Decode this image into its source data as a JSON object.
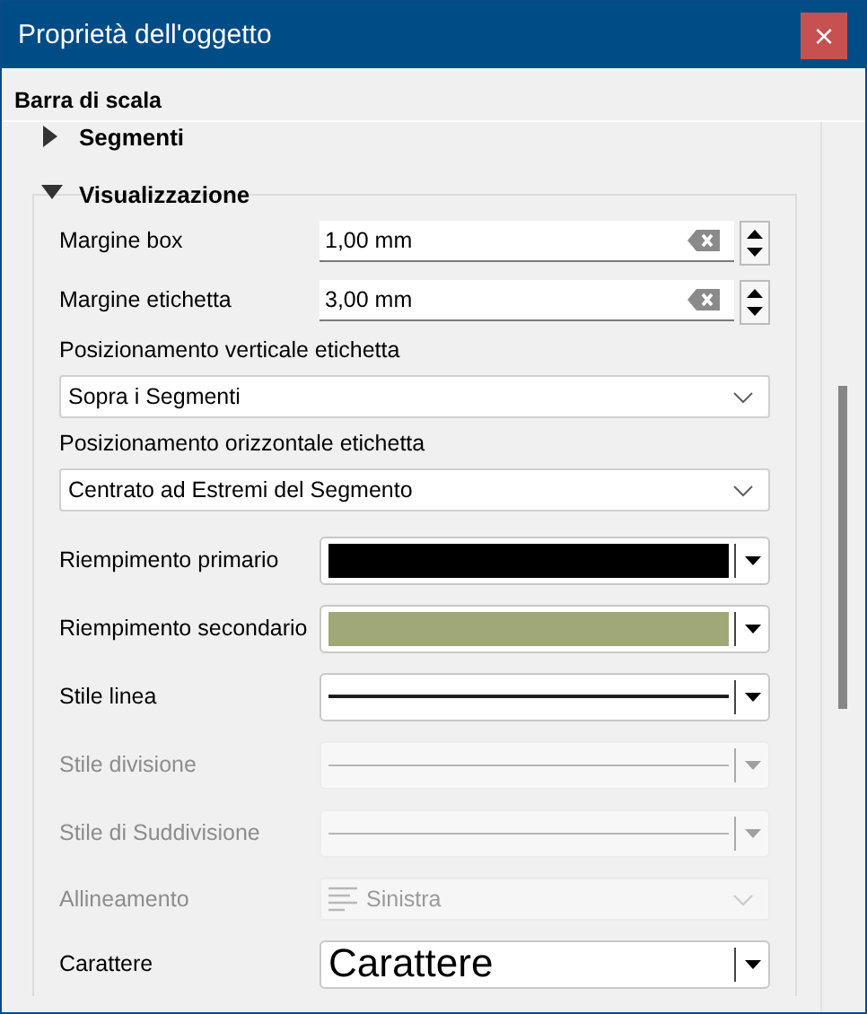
{
  "window": {
    "title": "Proprietà dell'oggetto",
    "close": "×"
  },
  "panel_title": "Barra di scala",
  "sections": [
    {
      "title": "Segmenti",
      "expanded": false
    },
    {
      "title": "Visualizzazione",
      "expanded": true,
      "rows": [
        {
          "kind": "spin",
          "label": "Margine box",
          "value": "1,00 mm",
          "disabled": false
        },
        {
          "kind": "spin",
          "label": "Margine etichetta",
          "value": "3,00 mm",
          "disabled": false
        },
        {
          "kind": "heading",
          "label": "Posizionamento verticale etichetta"
        },
        {
          "kind": "combo",
          "value": "Sopra i Segmenti",
          "disabled": false
        },
        {
          "kind": "heading",
          "label": "Posizionamento orizzontale etichetta"
        },
        {
          "kind": "combo",
          "value": "Centrato ad Estremi del Segmento",
          "disabled": false
        },
        {
          "kind": "color",
          "label": "Riempimento primario",
          "color": "#000000",
          "disabled": false
        },
        {
          "kind": "color",
          "label": "Riempimento secondario",
          "color": "#a0a878",
          "disabled": false
        },
        {
          "kind": "line",
          "label": "Stile linea",
          "disabled": false
        },
        {
          "kind": "line",
          "label": "Stile divisione",
          "disabled": true
        },
        {
          "kind": "line",
          "label": "Stile di Suddivisione",
          "disabled": true
        },
        {
          "kind": "align",
          "label": "Allineamento",
          "value": "Sinistra",
          "disabled": true
        },
        {
          "kind": "font",
          "label": "Carattere",
          "value": "Carattere",
          "disabled": false
        }
      ]
    }
  ]
}
